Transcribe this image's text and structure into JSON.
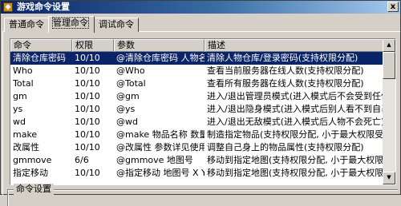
{
  "window": {
    "title": "游戏命令设置",
    "close_glyph": "x"
  },
  "tabs": [
    {
      "label": "普通命令",
      "active": false
    },
    {
      "label": "管理命令",
      "active": true
    },
    {
      "label": "调试命令",
      "active": false
    }
  ],
  "list": {
    "columns": [
      "命令",
      "权限",
      "参数",
      "描述"
    ],
    "rows": [
      {
        "cmd": "清除仓库密码",
        "perm": "10/10",
        "param": "@清除仓库密码 人物名称",
        "desc": "清除人物仓库/登录密码(支持权限分配)",
        "selected": true
      },
      {
        "cmd": "Who",
        "perm": "10/10",
        "param": "@Who",
        "desc": "查看当前服务器在线人数(支持权限分配)",
        "selected": false
      },
      {
        "cmd": "Total",
        "perm": "10/10",
        "param": "@Total",
        "desc": "查看所有服务器在线人数(支持权限分配)",
        "selected": false
      },
      {
        "cmd": "gm",
        "perm": "10/10",
        "param": "@gm",
        "desc": "进入/退出管理员模式(进入模式后不会受到任何",
        "selected": false
      },
      {
        "cmd": "ys",
        "perm": "10/10",
        "param": "@ys",
        "desc": "进入/退出隐身模式(进入模式后别人看不到自己",
        "selected": false
      },
      {
        "cmd": "wd",
        "perm": "10/10",
        "param": "@wd",
        "desc": "进入/退出无敌模式(进入模式后人物不会死亡)",
        "selected": false
      },
      {
        "cmd": "make",
        "perm": "10/10",
        "param": "@make 物品名称 数量",
        "desc": "制造指定物品(支持权限分配, 小于最大权限受",
        "selected": false
      },
      {
        "cmd": "改属性",
        "perm": "10/10",
        "param": "@改属性 参数详见使用说明",
        "desc": "调整自己身上的物品属性(支持权限分配)",
        "selected": false
      },
      {
        "cmd": "gmmove",
        "perm": "6/6",
        "param": "@gmmove 地图号",
        "desc": "移动到指定地图(支持权限分配, 小于最大权限",
        "selected": false
      },
      {
        "cmd": "指定移动",
        "perm": "10/10",
        "param": "@指定移动 地图号 X Y",
        "desc": "移动到指定地图(支持权限分配, 小于最大权限",
        "selected": false
      }
    ]
  },
  "scrollbar": {
    "up_glyph": "▲",
    "down_glyph": "▼"
  },
  "settings_group": {
    "label": "命令设置"
  }
}
